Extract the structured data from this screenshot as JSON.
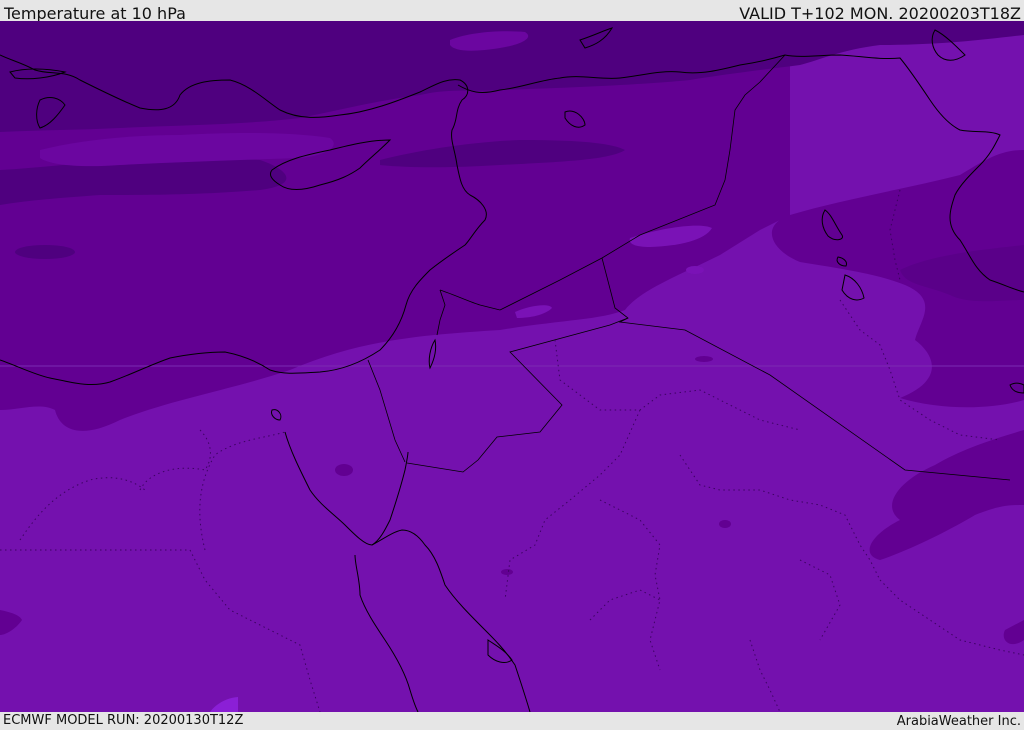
{
  "header": {
    "title": "Temperature at 10 hPa",
    "valid": "VALID T+102 MON. 20200203T18Z"
  },
  "footer": {
    "model_run": "ECMWF MODEL RUN: 20200130T12Z",
    "credit": "ArabiaWeather Inc."
  },
  "map": {
    "field": "temperature",
    "level": "10 hPa",
    "region": "Eastern Mediterranean and Middle East",
    "colors": {
      "coldest": "#4f007f",
      "cold": "#620092",
      "mid": "#7411ae",
      "warm": "#8b1fd6",
      "coastline": "#000000"
    }
  }
}
